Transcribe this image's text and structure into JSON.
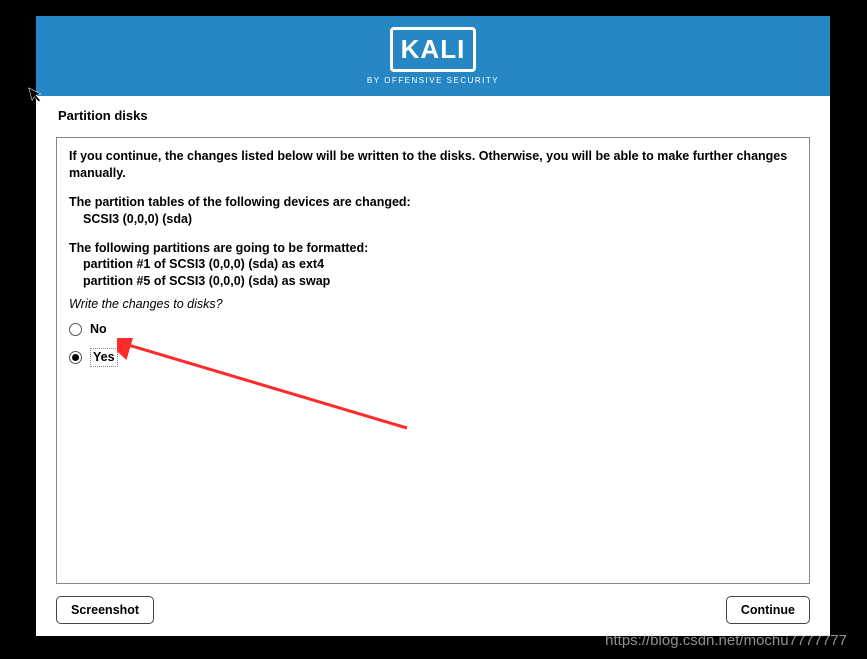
{
  "header": {
    "logo_text": "KALI",
    "logo_subtitle": "BY OFFENSIVE SECURITY"
  },
  "page": {
    "title": "Partition disks"
  },
  "content": {
    "warning": "If you continue, the changes listed below will be written to the disks. Otherwise, you will be able to make further changes manually.",
    "tables_heading": "The partition tables of the following devices are changed:",
    "tables_device": "SCSI3 (0,0,0) (sda)",
    "format_heading": "The following partitions are going to be formatted:",
    "format_line1": "partition #1 of SCSI3 (0,0,0) (sda) as ext4",
    "format_line2": "partition #5 of SCSI3 (0,0,0) (sda) as swap",
    "question": "Write the changes to disks?",
    "option_no": "No",
    "option_yes": "Yes"
  },
  "buttons": {
    "screenshot": "Screenshot",
    "continue": "Continue"
  },
  "watermark": "https://blog.csdn.net/mochu7777777"
}
